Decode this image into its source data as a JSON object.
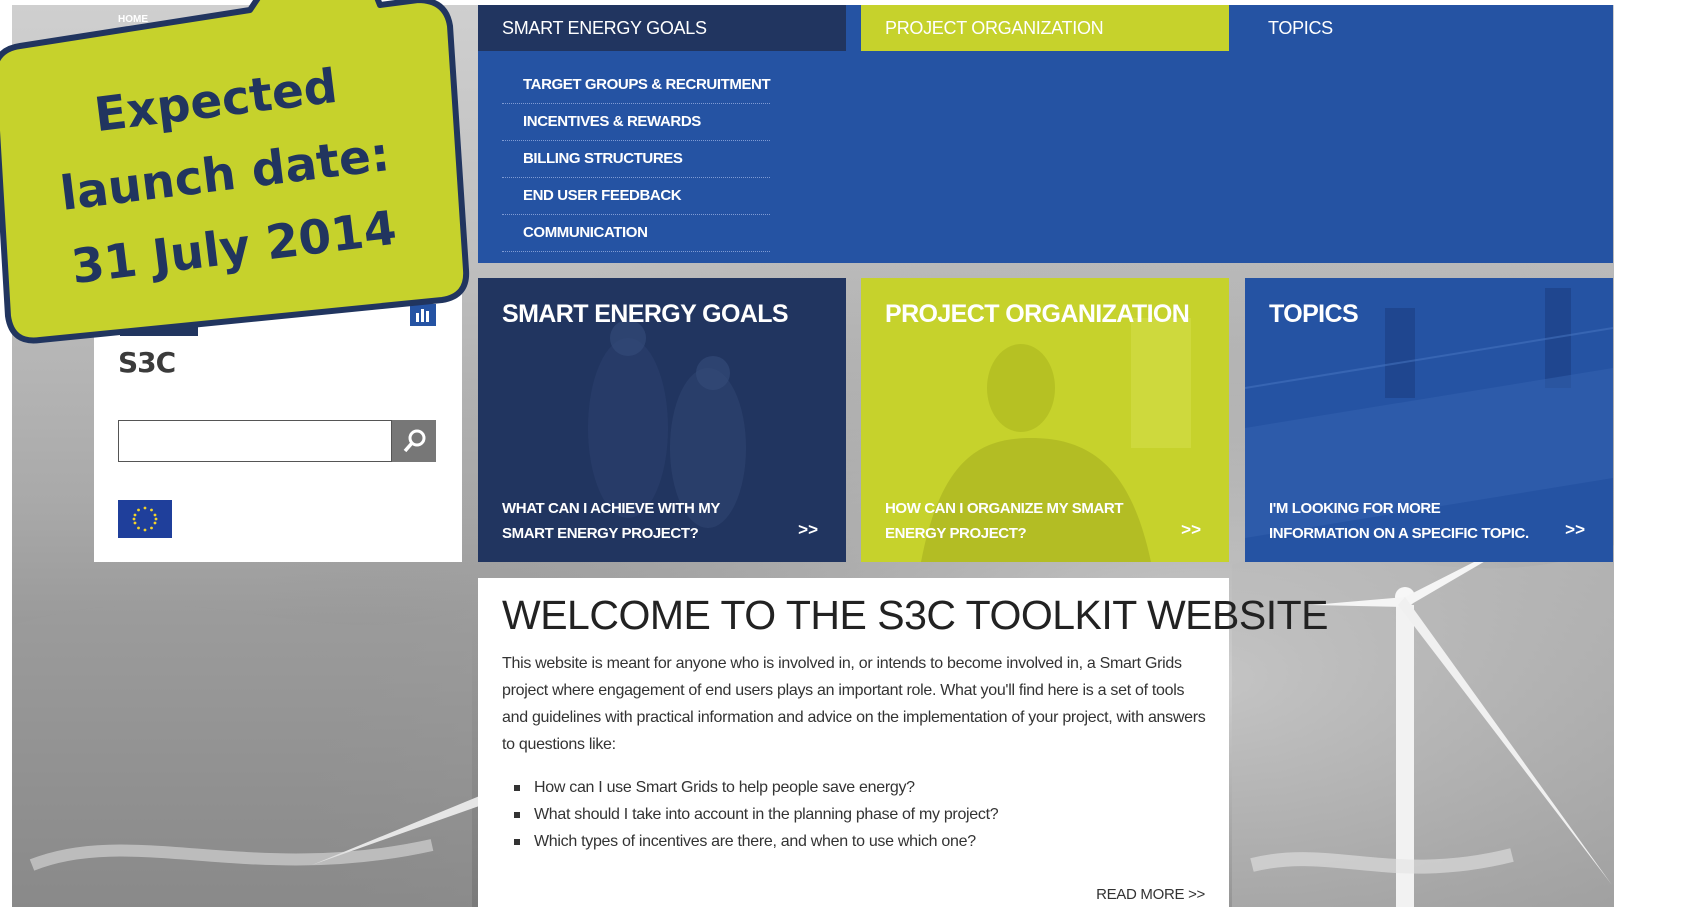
{
  "breadcrumb": "HOME",
  "nav": {
    "tabs": [
      "SMART ENERGY GOALS",
      "PROJECT ORGANIZATION",
      "TOPICS"
    ],
    "submenu": [
      "TARGET GROUPS & RECRUITMENT",
      "INCENTIVES & REWARDS",
      "BILLING STRUCTURES",
      "END USER FEEDBACK",
      "COMMUNICATION"
    ]
  },
  "sidebar": {
    "logo_text": "S3C",
    "search": {
      "placeholder": ""
    }
  },
  "cards": [
    {
      "title": "SMART ENERGY GOALS",
      "subtitle": "WHAT CAN I ACHIEVE WITH MY SMART ENERGY PROJECT?",
      "arrow": ">>"
    },
    {
      "title": "PROJECT ORGANIZATION",
      "subtitle": "HOW CAN I ORGANIZE MY SMART ENERGY PROJECT?",
      "arrow": ">>"
    },
    {
      "title": "TOPICS",
      "subtitle": "I'M LOOKING FOR MORE INFORMATION ON A SPECIFIC TOPIC.",
      "arrow": ">>"
    }
  ],
  "welcome": {
    "title": "WELCOME TO THE S3C TOOLKIT WEBSITE",
    "intro": "This website is meant for anyone who is involved in, or intends to become involved in, a Smart Grids project where engagement of end users plays an important role. What you'll find here is a set of tools and guidelines with practical information and advice on the implementation of your project, with answers to questions like:",
    "bullets": [
      "How can I use Smart Grids to help people save energy?",
      "What should I take into account in the planning phase of my project?",
      "Which types of incentives are there, and when to use which one?"
    ],
    "read_more": "READ MORE >>"
  },
  "sticker": {
    "lines": [
      "Expected",
      "launch date:",
      "31 July 2014"
    ]
  },
  "colors": {
    "navy": "#213560",
    "lime": "#c6d22c",
    "blue": "#2553a3"
  }
}
